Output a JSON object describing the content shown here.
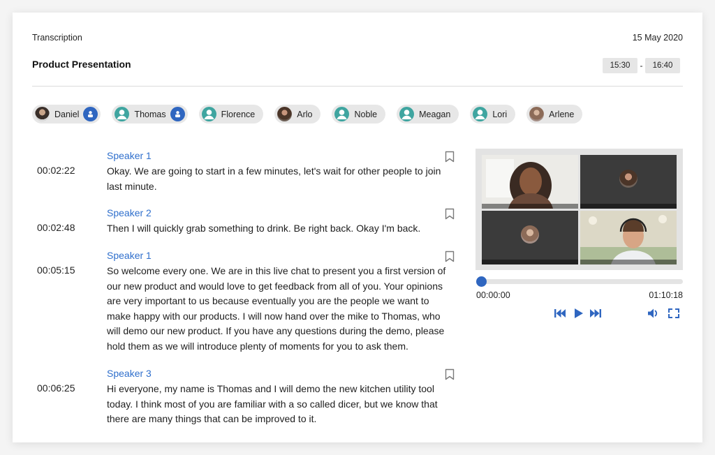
{
  "header": {
    "label": "Transcription",
    "date": "15 May 2020",
    "title": "Product Presentation",
    "time_start": "15:30",
    "time_separator": "-",
    "time_end": "16:40"
  },
  "participants": [
    {
      "name": "Daniel",
      "avatar": "photo",
      "badge": "person-icon"
    },
    {
      "name": "Thomas",
      "avatar": "teal-person",
      "badge": "person-icon"
    },
    {
      "name": "Florence",
      "avatar": "teal-person"
    },
    {
      "name": "Arlo",
      "avatar": "photo"
    },
    {
      "name": "Noble",
      "avatar": "teal-person"
    },
    {
      "name": "Meagan",
      "avatar": "teal-person"
    },
    {
      "name": "Lori",
      "avatar": "teal-person"
    },
    {
      "name": "Arlene",
      "avatar": "photo"
    }
  ],
  "transcript": [
    {
      "speaker": "Speaker 1",
      "time": "00:02:22",
      "text": "Okay. We are going to start in a few minutes, let's wait for other people to join last minute."
    },
    {
      "speaker": "Speaker 2",
      "time": "00:02:48",
      "text": "Then I will quickly grab something to drink. Be right back. Okay I'm back."
    },
    {
      "speaker": "Speaker 1",
      "time": "00:05:15",
      "text": "So welcome every one. We are in this live chat to present you a first version of our new product and would love to get feedback from all of you. Your opinions are very important to us because eventually you are the people we want to make happy with our products. I will now hand over the mike to Thomas, who will demo our new product. If you have any questions during the demo, please hold them as we will introduce plenty of moments for you to ask them."
    },
    {
      "speaker": "Speaker 3",
      "time": "00:06:25",
      "text": "Hi everyone, my name is Thomas and I will demo the new kitchen utility tool today. I think most of you are familiar with a so called dicer, but we know that there are many things that can be improved to it."
    }
  ],
  "player": {
    "current_time": "00:00:00",
    "duration": "01:10:18",
    "progress_fraction": 0,
    "controls": [
      "skip-back-icon",
      "play-icon",
      "skip-forward-icon",
      "volume-icon",
      "fullscreen-icon"
    ]
  },
  "colors": {
    "accent": "#2f66c0",
    "speaker_link": "#2f6fcc",
    "chip_bg": "#e7e7e7",
    "teal_avatar": "#3fa5a0"
  }
}
